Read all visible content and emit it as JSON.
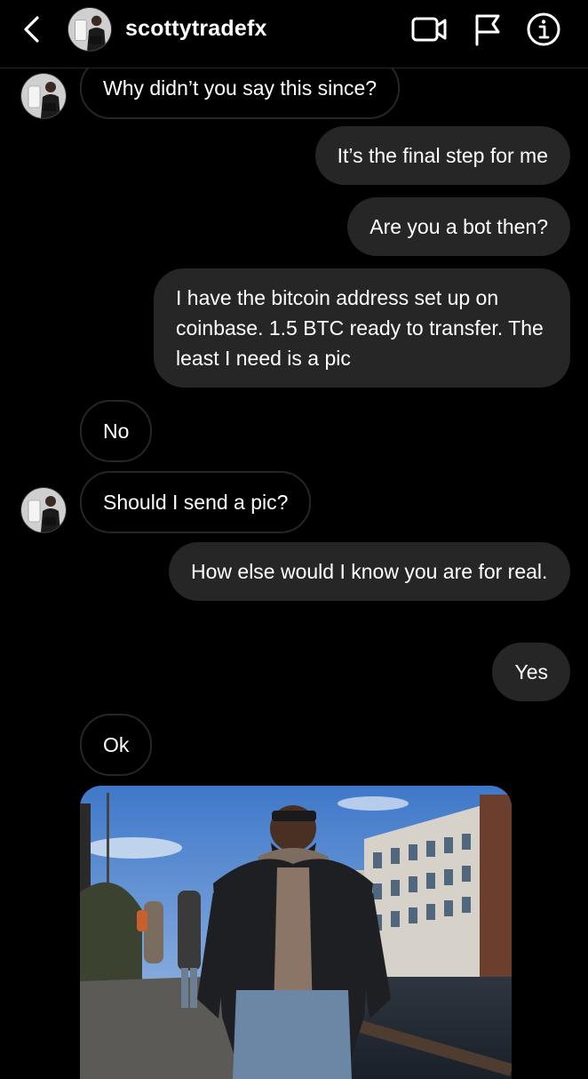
{
  "header": {
    "username": "scottytradefx",
    "icons": [
      "back-icon",
      "video-call-icon",
      "flag-icon",
      "info-icon"
    ]
  },
  "colors": {
    "background": "#000000",
    "sent_bubble": "#262626",
    "received_border": "#262626",
    "text": "#ffffff"
  },
  "messages": [
    {
      "from": "them",
      "text": "Why didn’t you say this since?"
    },
    {
      "from": "me",
      "text": "It’s the final step for me"
    },
    {
      "from": "me",
      "text": "Are you a bot then?"
    },
    {
      "from": "me",
      "text": "I have the bitcoin address set up on coinbase. 1.5 BTC ready to transfer. The least I need is a pic"
    },
    {
      "from": "them",
      "text": "No"
    },
    {
      "from": "them",
      "text": "Should I send a pic?"
    },
    {
      "from": "me",
      "text": "How else would I know you are for real."
    },
    {
      "from": "me",
      "text": "Yes"
    },
    {
      "from": "them",
      "text": "Ok"
    },
    {
      "from": "them",
      "type": "photo"
    }
  ]
}
